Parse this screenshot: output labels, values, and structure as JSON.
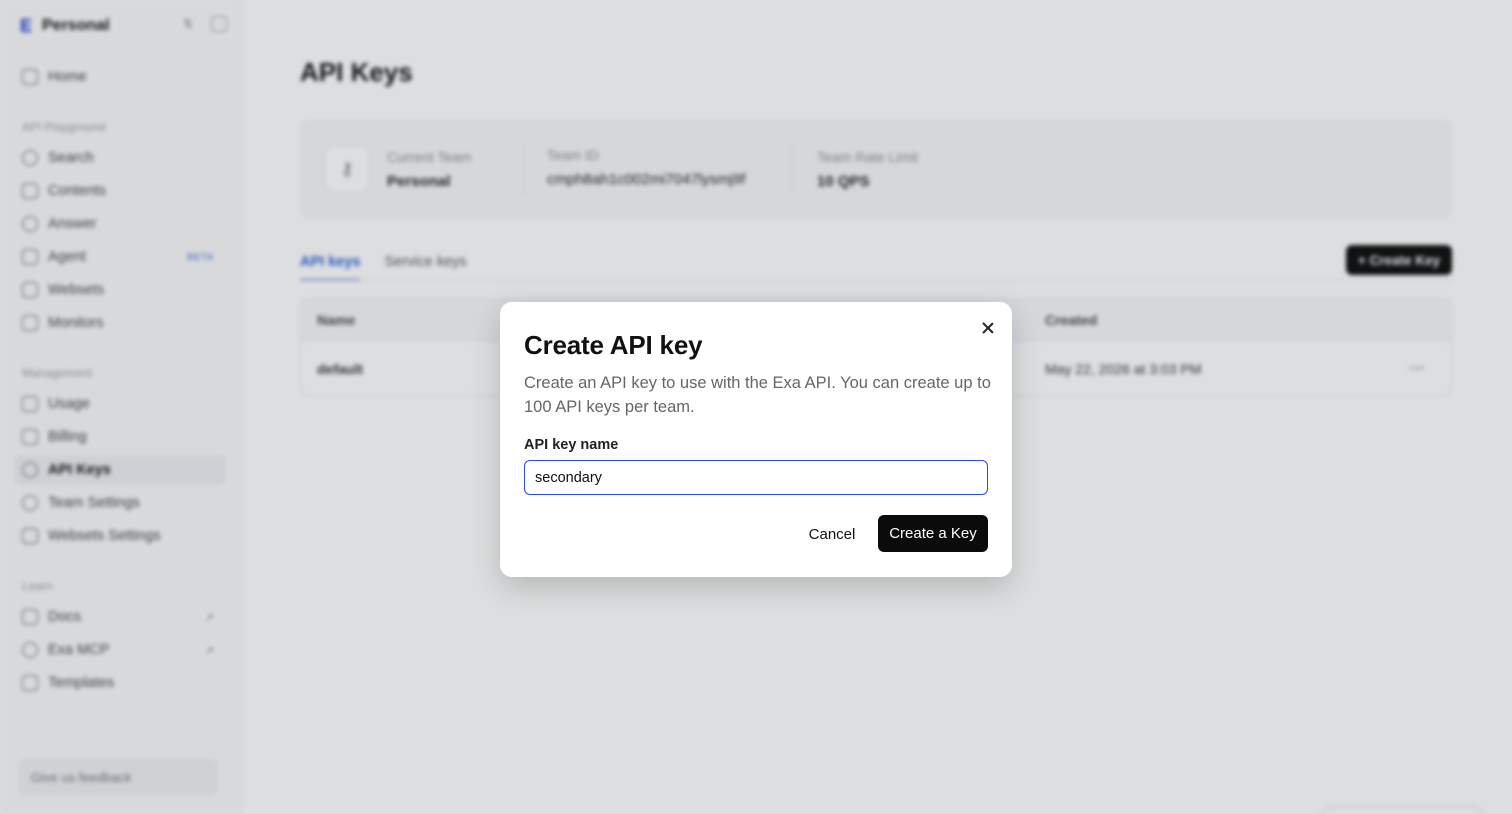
{
  "sidebar": {
    "team_name": "Personal",
    "nav": [
      {
        "label": "Home",
        "icon": "home-icon"
      }
    ],
    "section_playground": "API Playground",
    "playground": [
      {
        "label": "Search",
        "icon": "search-icon"
      },
      {
        "label": "Contents",
        "icon": "document-icon"
      },
      {
        "label": "Answer",
        "icon": "chat-bubble-icon"
      },
      {
        "label": "Agent",
        "icon": "agent-icon",
        "badge": "BETA"
      },
      {
        "label": "Websets",
        "icon": "grid-icon"
      },
      {
        "label": "Monitors",
        "icon": "monitor-icon"
      }
    ],
    "section_management": "Management",
    "management": [
      {
        "label": "Usage",
        "icon": "chart-icon"
      },
      {
        "label": "Billing",
        "icon": "billing-icon"
      },
      {
        "label": "API Keys",
        "icon": "key-icon"
      },
      {
        "label": "Team Settings",
        "icon": "team-icon"
      },
      {
        "label": "Websets Settings",
        "icon": "grid-icon"
      }
    ],
    "section_learn": "Learn",
    "learn": [
      {
        "label": "Docs",
        "icon": "book-icon"
      },
      {
        "label": "Exa MCP",
        "icon": "network-icon"
      },
      {
        "label": "Templates",
        "icon": "template-icon"
      }
    ],
    "feedback": "Give us feedback"
  },
  "main": {
    "title": "API Keys",
    "team_card": {
      "current_team_label": "Current Team",
      "current_team_value": "Personal",
      "team_id_label": "Team ID",
      "team_id_value": "cmph8ah1c002mi7047lysmj9f",
      "rate_limit_label": "Team Rate Limit",
      "rate_limit_value": "10 QPS"
    },
    "tabs": [
      "API keys",
      "Service keys"
    ],
    "create_key_button": "+ Create Key",
    "table": {
      "headers": {
        "name": "Name",
        "created": "Created"
      },
      "rows": [
        {
          "name": "default",
          "created": "May 22, 2026 at 3:03 PM"
        }
      ]
    }
  },
  "modal": {
    "title": "Create API key",
    "description": "Create an API key to use with the Exa API. You can create up to 100 API keys per team.",
    "field_label": "API key name",
    "field_value": "secondary",
    "cancel_label": "Cancel",
    "submit_label": "Create a Key"
  },
  "colors": {
    "accent": "#2f5fd6",
    "primary_button": "#0b0b0b",
    "input_focus": "#2b4bd0"
  }
}
